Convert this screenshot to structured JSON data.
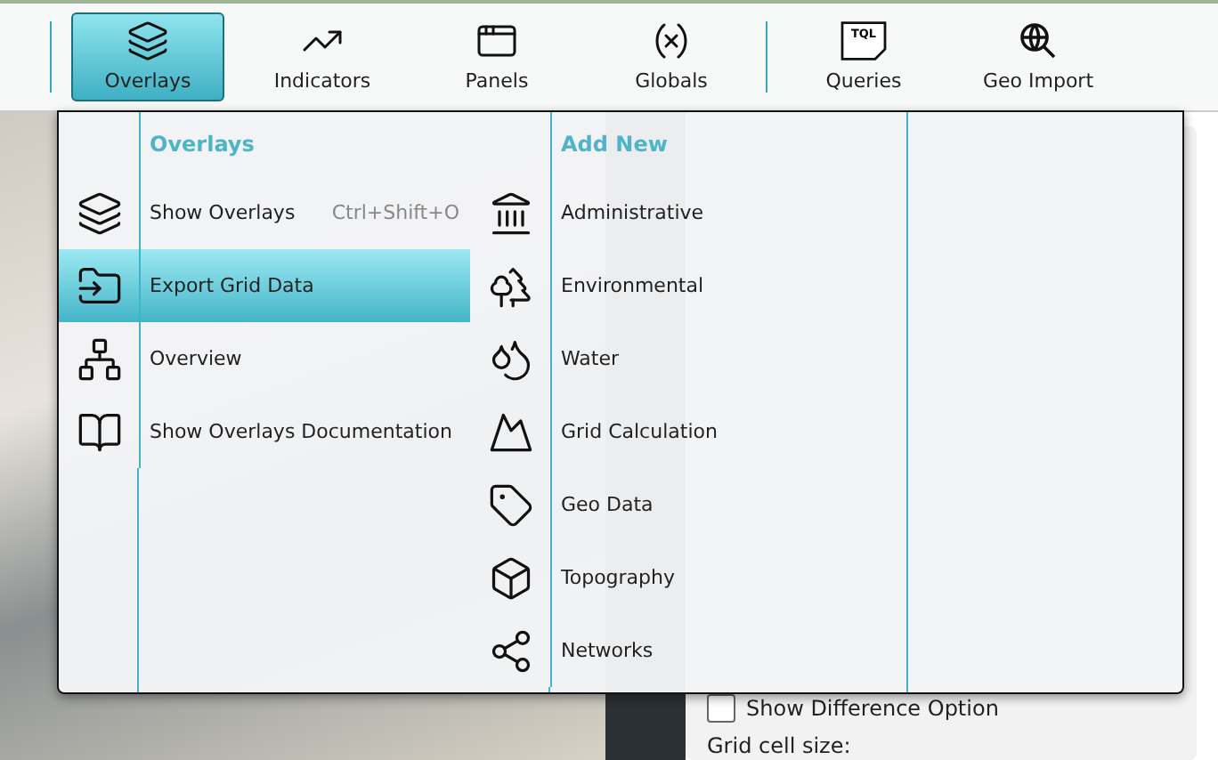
{
  "toolbar": {
    "groups": [
      [
        {
          "label": "Overlays",
          "selected": true
        },
        {
          "label": "Indicators",
          "selected": false
        },
        {
          "label": "Panels",
          "selected": false
        },
        {
          "label": "Globals",
          "selected": false
        }
      ],
      [
        {
          "label": "Queries",
          "badge": "TQL",
          "selected": false
        },
        {
          "label": "Geo Import",
          "selected": false
        }
      ]
    ]
  },
  "menu": {
    "columns": [
      {
        "heading": "Overlays",
        "items": [
          {
            "label": "Show Overlays",
            "shortcut": "Ctrl+Shift+O",
            "selected": false
          },
          {
            "label": "Export Grid Data",
            "selected": true
          },
          {
            "label": "Overview",
            "selected": false
          },
          {
            "label": "Show Overlays Documentation",
            "selected": false
          }
        ]
      },
      {
        "heading": "Add New",
        "items": [
          {
            "label": "Administrative",
            "selected": false
          },
          {
            "label": "Environmental",
            "selected": false
          },
          {
            "label": "Water",
            "selected": false
          },
          {
            "label": "Grid Calculation",
            "selected": false
          },
          {
            "label": "Geo Data",
            "selected": false
          },
          {
            "label": "Topography",
            "selected": false
          },
          {
            "label": "Networks",
            "selected": false
          }
        ]
      }
    ]
  },
  "panel": {
    "options": [
      {
        "label": "Show Difference Option",
        "checked": false
      }
    ],
    "grid_cell_label": "Grid cell size:"
  }
}
